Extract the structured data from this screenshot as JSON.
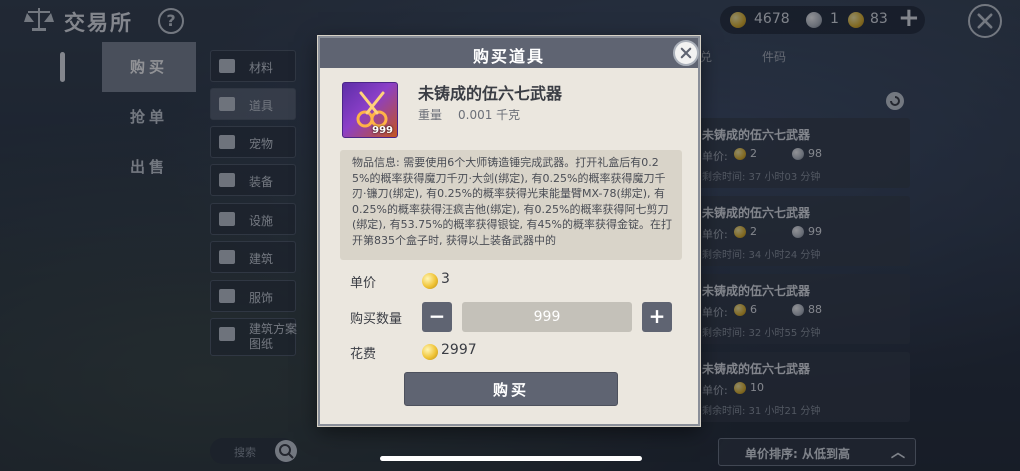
{
  "header": {
    "title": "交易所",
    "help_label": "?",
    "currencies": [
      {
        "icon": "gold-coin-icon",
        "value": "4678"
      },
      {
        "icon": "silver-coin-icon",
        "value": "1"
      },
      {
        "icon": "gold-coin-icon",
        "value": "83"
      }
    ],
    "plus_label": "+"
  },
  "main_nav": [
    {
      "label": "购买",
      "active": true
    },
    {
      "label": "抢单",
      "active": false
    },
    {
      "label": "出售",
      "active": false
    }
  ],
  "categories": [
    {
      "label": "材料",
      "icon": "material-icon"
    },
    {
      "label": "道具",
      "icon": "flask-icon",
      "active": true
    },
    {
      "label": "宠物",
      "icon": "paw-icon"
    },
    {
      "label": "装备",
      "icon": "equipment-icon"
    },
    {
      "label": "设施",
      "icon": "facility-icon"
    },
    {
      "label": "建筑",
      "icon": "building-icon"
    },
    {
      "label": "服饰",
      "icon": "clothing-icon"
    },
    {
      "label": "建筑方案图纸",
      "icon": "blueprint-icon"
    }
  ],
  "search": {
    "placeholder": "搜索"
  },
  "list_tabs": [
    "兑",
    "件码"
  ],
  "listings": [
    {
      "name": "未铸成的伍六七武器",
      "price_label": "单价:",
      "price": "2",
      "qty": "98",
      "time": "剩余时间: 37 小时03 分钟"
    },
    {
      "name": "未铸成的伍六七武器",
      "price_label": "单价:",
      "price": "2",
      "qty": "99",
      "time": "剩余时间: 34 小时24 分钟"
    },
    {
      "name": "未铸成的伍六七武器",
      "price_label": "单价:",
      "price": "6",
      "qty": "88",
      "time": "剩余时间: 32 小时55 分钟"
    },
    {
      "name": "未铸成的伍六七武器",
      "price_label": "单价:",
      "price": "10",
      "qty": "",
      "time": "剩余时间: 31 小时21 分钟"
    }
  ],
  "sort": {
    "label": "单价排序: 从低到高"
  },
  "modal": {
    "title": "购买道具",
    "item": {
      "name": "未铸成的伍六七武器",
      "weight_label": "重量",
      "weight": "0.001 千克",
      "stack": "999"
    },
    "description": "物品信息: 需要使用6个大师铸造锤完成武器。打开礼盒后有0.25%的概率获得魔刀千刃·大剑(绑定), 有0.25%的概率获得魔刀千刃·镰刀(绑定), 有0.25%的概率获得光束能量臂MX-78(绑定), 有0.25%的概率获得汪疯吉他(绑定), 有0.25%的概率获得阿七剪刀(绑定), 有53.75%的概率获得银锭, 有45%的概率获得金锭。在打开第835个盒子时, 获得以上装备武器中的",
    "unit_price_label": "单价",
    "unit_price": "3",
    "quantity_label": "购买数量",
    "quantity": "999",
    "minus_label": "−",
    "plus_label": "+",
    "cost_label": "花费",
    "cost": "2997",
    "buy_label": "购买"
  }
}
